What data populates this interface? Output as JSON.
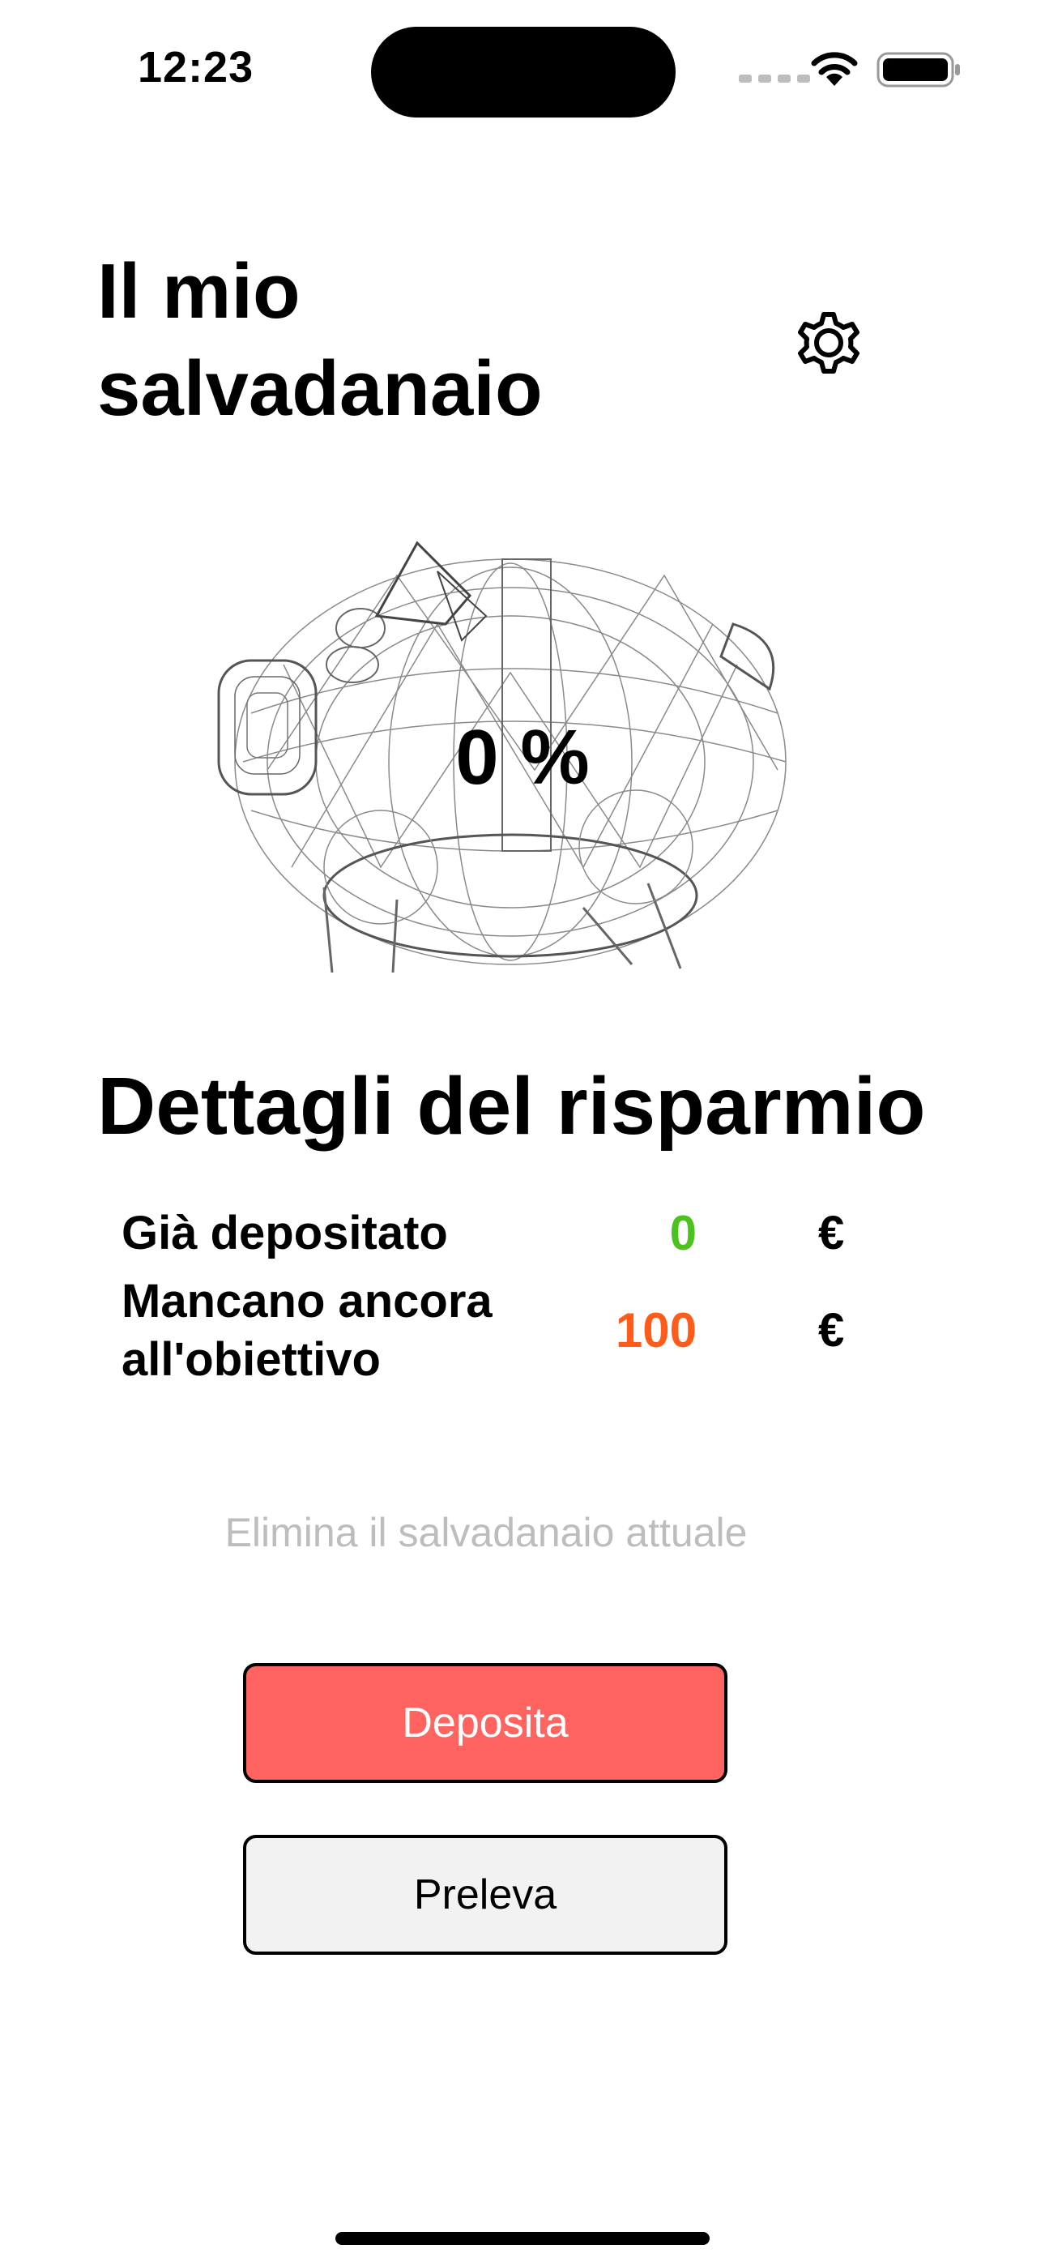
{
  "status_bar": {
    "time": "12:23",
    "wifi_icon": "wifi-icon",
    "battery_icon": "battery-icon"
  },
  "header": {
    "title": "Il mio salvadanaio",
    "settings_icon": "gear-icon"
  },
  "piggy": {
    "icon": "piggy-bank-wireframe-icon",
    "percent": "0 %"
  },
  "details": {
    "title": "Dettagli del risparmio",
    "deposited_label": "Già depositato",
    "deposited_value": "0",
    "deposited_currency": "€",
    "remaining_label": "Mancano ancora all'obiettivo",
    "remaining_value": "100",
    "remaining_currency": "€"
  },
  "actions": {
    "delete_label": "Elimina il salvadanaio attuale",
    "deposit_label": "Deposita",
    "withdraw_label": "Preleva"
  },
  "colors": {
    "deposited": "#4cc21c",
    "remaining": "#ff5b1a",
    "deposit_button": "#ff6461",
    "withdraw_button": "#f2f2f2",
    "delete_text": "#bdbdbd"
  }
}
